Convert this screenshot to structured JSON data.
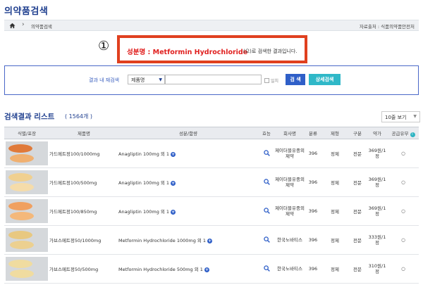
{
  "page": {
    "title": "의약품검색"
  },
  "breadcrumb": {
    "item": "의약품검색",
    "source": "자료출처 : 식품의약품안전처"
  },
  "callout": {
    "number": "①",
    "term": "성분명 : Metformin Hydrochloride",
    "suffix": "(으)로 검색한 결과입니다."
  },
  "search": {
    "label": "결과 내 재검색",
    "select_value": "제품명",
    "input_value": "",
    "checkbox_label": "일치",
    "search_button": "검 색",
    "detail_button": "상세검색"
  },
  "list": {
    "title": "검색결과 리스트",
    "count": "( 1564개 )",
    "page_size": "10줄 보기"
  },
  "table": {
    "headers": [
      "식별/포장",
      "제품명",
      "성분/함량",
      "효능",
      "회사명",
      "분류",
      "제형",
      "구분",
      "약가",
      "공급유무"
    ],
    "rows": [
      {
        "name": "가드메트정100/1000mg",
        "ingredient": "Anagliptin 100mg 외 1",
        "company": "제이더블유중외제약",
        "class": "396",
        "form": "정제",
        "type": "전문",
        "price": "369원/1정",
        "supply": "○",
        "pill_a": "#e07a3a",
        "pill_b": "#f0b070"
      },
      {
        "name": "가드메트정100/500mg",
        "ingredient": "Anagliptin 100mg 외 1",
        "company": "제이더블유중외제약",
        "class": "396",
        "form": "정제",
        "type": "전문",
        "price": "369원/1정",
        "supply": "○",
        "pill_a": "#f0d090",
        "pill_b": "#f5dcaa"
      },
      {
        "name": "가드메트정100/850mg",
        "ingredient": "Anagliptin 100mg 외 1",
        "company": "제이더블유중외제약",
        "class": "396",
        "form": "정제",
        "type": "전문",
        "price": "369원/1정",
        "supply": "○",
        "pill_a": "#f0a060",
        "pill_b": "#f4b87a"
      },
      {
        "name": "가브스메트정50/1000mg",
        "ingredient": "Metformin Hydrochloride 1000mg 외 1",
        "company": "한국노바티스",
        "class": "396",
        "form": "정제",
        "type": "전문",
        "price": "333원/1정",
        "supply": "○",
        "pill_a": "#e8c880",
        "pill_b": "#ecd090"
      },
      {
        "name": "가브스메트정50/500mg",
        "ingredient": "Metformin Hydrochloride 500mg 외 1",
        "company": "한국노바티스",
        "class": "396",
        "form": "정제",
        "type": "전문",
        "price": "310원/1정",
        "supply": "○",
        "pill_a": "#f0dca0",
        "pill_b": "#f0dca0"
      }
    ]
  }
}
